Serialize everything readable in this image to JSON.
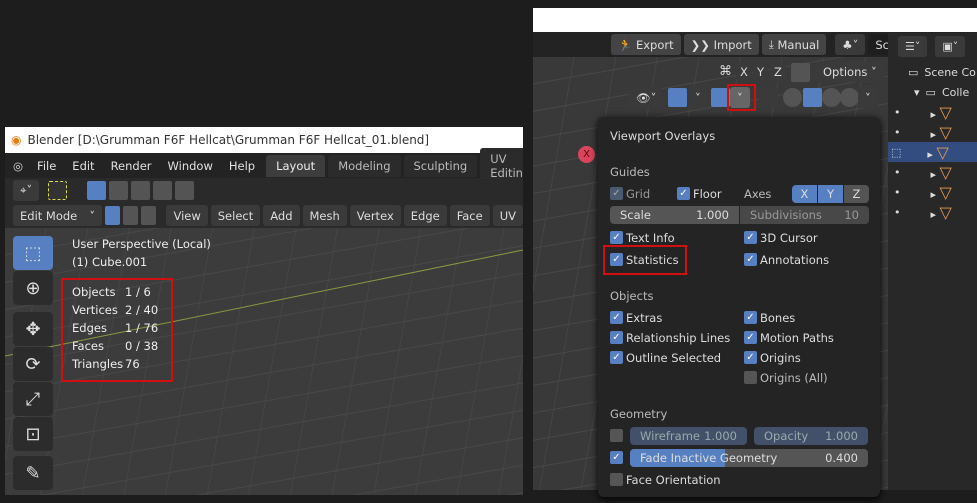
{
  "left_window": {
    "title": "Blender [D:\\Grumman F6F Hellcat\\Grumman F6F Hellcat_01.blend]",
    "menu": [
      "File",
      "Edit",
      "Render",
      "Window",
      "Help"
    ],
    "workspace_tabs": [
      "Layout",
      "Modeling",
      "Sculpting",
      "UV Editing"
    ],
    "active_tab": "Layout",
    "mode": "Edit Mode",
    "header_menus": [
      "View",
      "Select",
      "Add",
      "Mesh",
      "Vertex",
      "Edge",
      "Face",
      "UV"
    ],
    "viewport_title": "User Perspective (Local)",
    "object_name": "(1) Cube.001",
    "stats": [
      {
        "label": "Objects",
        "value": "1 / 6"
      },
      {
        "label": "Vertices",
        "value": "2 / 40"
      },
      {
        "label": "Edges",
        "value": "1 / 76"
      },
      {
        "label": "Faces",
        "value": "0 / 38"
      },
      {
        "label": "Triangles",
        "value": "76"
      }
    ],
    "tools": [
      "select-box-icon",
      "cursor-icon",
      "move-icon",
      "rotate-icon",
      "scale-icon",
      "transform-icon",
      "annotate-icon"
    ]
  },
  "right_window": {
    "topbar": {
      "export": "Export",
      "import": "Import",
      "manual": "Manual",
      "scene": "Scene"
    },
    "gizmo_axes": [
      "X",
      "Y",
      "Z"
    ],
    "options": "Options",
    "outliner": {
      "scene_collection": "Scene Co",
      "collection": "Colle"
    },
    "overlays": {
      "title": "Viewport Overlays",
      "guides": {
        "heading": "Guides",
        "grid": "Grid",
        "floor": "Floor",
        "axes": "Axes",
        "axes_buttons": [
          "X",
          "Y",
          "Z"
        ],
        "scale_label": "Scale",
        "scale_value": "1.000",
        "subdiv_label": "Subdivisions",
        "subdiv_value": "10"
      },
      "info": [
        {
          "label": "Text Info",
          "checked": true
        },
        {
          "label": "3D Cursor",
          "checked": true
        },
        {
          "label": "Statistics",
          "checked": true
        },
        {
          "label": "Annotations",
          "checked": true
        }
      ],
      "objects": {
        "heading": "Objects",
        "items": [
          {
            "label": "Extras",
            "checked": true
          },
          {
            "label": "Bones",
            "checked": true
          },
          {
            "label": "Relationship Lines",
            "checked": true
          },
          {
            "label": "Motion Paths",
            "checked": true
          },
          {
            "label": "Outline Selected",
            "checked": true
          },
          {
            "label": "Origins",
            "checked": true
          },
          {
            "label": "Origins (All)",
            "checked": false
          }
        ]
      },
      "geometry": {
        "heading": "Geometry",
        "wireframe_label": "Wireframe",
        "wireframe_value": "1.000",
        "opacity_label": "Opacity",
        "opacity_value": "1.000",
        "fade_label": "Fade Inactive Geometry",
        "fade_value": "0.400",
        "fade_fraction": 0.4,
        "face_orientation": "Face Orientation"
      }
    }
  },
  "colors": {
    "accent": "#5680c2",
    "highlight": "#d01010",
    "object": "#e59a50"
  }
}
